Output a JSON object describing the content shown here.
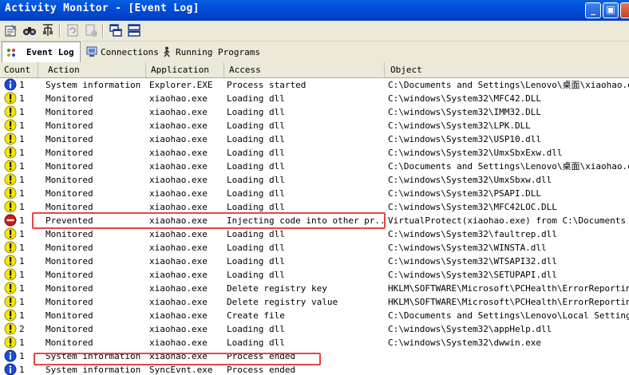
{
  "window": {
    "title": "Activity Monitor - [Event Log]"
  },
  "tabs": [
    {
      "label": "Event Log",
      "active": true
    },
    {
      "label": "Connections",
      "active": false
    },
    {
      "label": "Running Programs",
      "active": false
    }
  ],
  "columns": [
    "Count",
    "Action",
    "Application",
    "Access",
    "Object"
  ],
  "rows": [
    {
      "icon": "info-icon",
      "count": "1",
      "action": "System information",
      "app": "Explorer.EXE",
      "access": "Process started",
      "object": "C:\\Documents and Settings\\Lenovo\\桌面\\xiaohao.exe"
    },
    {
      "icon": "warning-icon",
      "count": "1",
      "action": "Monitored",
      "app": "xiaohao.exe",
      "access": "Loading dll",
      "object": "C:\\windows\\System32\\MFC42.DLL"
    },
    {
      "icon": "warning-icon",
      "count": "1",
      "action": "Monitored",
      "app": "xiaohao.exe",
      "access": "Loading dll",
      "object": "C:\\windows\\System32\\IMM32.DLL"
    },
    {
      "icon": "warning-icon",
      "count": "1",
      "action": "Monitored",
      "app": "xiaohao.exe",
      "access": "Loading dll",
      "object": "C:\\windows\\System32\\LPK.DLL"
    },
    {
      "icon": "warning-icon",
      "count": "1",
      "action": "Monitored",
      "app": "xiaohao.exe",
      "access": "Loading dll",
      "object": "C:\\windows\\System32\\USP10.dll"
    },
    {
      "icon": "warning-icon",
      "count": "1",
      "action": "Monitored",
      "app": "xiaohao.exe",
      "access": "Loading dll",
      "object": "C:\\windows\\System32\\UmxSbxExw.dll"
    },
    {
      "icon": "warning-icon",
      "count": "1",
      "action": "Monitored",
      "app": "xiaohao.exe",
      "access": "Loading dll",
      "object": "C:\\Documents and Settings\\Lenovo\\桌面\\xiaohao.exe"
    },
    {
      "icon": "warning-icon",
      "count": "1",
      "action": "Monitored",
      "app": "xiaohao.exe",
      "access": "Loading dll",
      "object": "C:\\windows\\System32\\UmxSbxw.dll"
    },
    {
      "icon": "warning-icon",
      "count": "1",
      "action": "Monitored",
      "app": "xiaohao.exe",
      "access": "Loading dll",
      "object": "C:\\windows\\System32\\PSAPI.DLL"
    },
    {
      "icon": "warning-icon",
      "count": "1",
      "action": "Monitored",
      "app": "xiaohao.exe",
      "access": "Loading dll",
      "object": "C:\\windows\\System32\\MFC42LOC.DLL"
    },
    {
      "icon": "prevented-icon",
      "count": "1",
      "action": "Prevented",
      "app": "xiaohao.exe",
      "access": "Injecting code into other pr...",
      "object": "VirtualProtect(xiaohao.exe) from C:\\Documents and"
    },
    {
      "icon": "warning-icon",
      "count": "1",
      "action": "Monitored",
      "app": "xiaohao.exe",
      "access": "Loading dll",
      "object": "C:\\windows\\System32\\faultrep.dll"
    },
    {
      "icon": "warning-icon",
      "count": "1",
      "action": "Monitored",
      "app": "xiaohao.exe",
      "access": "Loading dll",
      "object": "C:\\windows\\System32\\WINSTA.dll"
    },
    {
      "icon": "warning-icon",
      "count": "1",
      "action": "Monitored",
      "app": "xiaohao.exe",
      "access": "Loading dll",
      "object": "C:\\windows\\System32\\WTSAPI32.dll"
    },
    {
      "icon": "warning-icon",
      "count": "1",
      "action": "Monitored",
      "app": "xiaohao.exe",
      "access": "Loading dll",
      "object": "C:\\windows\\System32\\SETUPAPI.dll"
    },
    {
      "icon": "warning-icon",
      "count": "1",
      "action": "Monitored",
      "app": "xiaohao.exe",
      "access": "Delete registry key",
      "object": "HKLM\\SOFTWARE\\Microsoft\\PCHealth\\ErrorReporting\\D"
    },
    {
      "icon": "warning-icon",
      "count": "1",
      "action": "Monitored",
      "app": "xiaohao.exe",
      "access": "Delete registry value",
      "object": "HKLM\\SOFTWARE\\Microsoft\\PCHealth\\ErrorReporting\\D"
    },
    {
      "icon": "warning-icon",
      "count": "1",
      "action": "Monitored",
      "app": "xiaohao.exe",
      "access": "Create file",
      "object": "C:\\Documents and Settings\\Lenovo\\Local Settings\\T"
    },
    {
      "icon": "warning-icon",
      "count": "2",
      "action": "Monitored",
      "app": "xiaohao.exe",
      "access": "Loading dll",
      "object": "C:\\windows\\System32\\appHelp.dll"
    },
    {
      "icon": "warning-icon",
      "count": "1",
      "action": "Monitored",
      "app": "xiaohao.exe",
      "access": "Loading dll",
      "object": "C:\\windows\\System32\\dwwin.exe"
    },
    {
      "icon": "info-icon",
      "count": "1",
      "action": "System information",
      "app": "xiaohao.exe",
      "access": "Process ended",
      "object": ""
    },
    {
      "icon": "info-icon",
      "count": "1",
      "action": "System information",
      "app": "SyncEvnt.exe",
      "access": "Process ended",
      "object": ""
    }
  ],
  "highlights": {
    "color": "#e84545"
  }
}
